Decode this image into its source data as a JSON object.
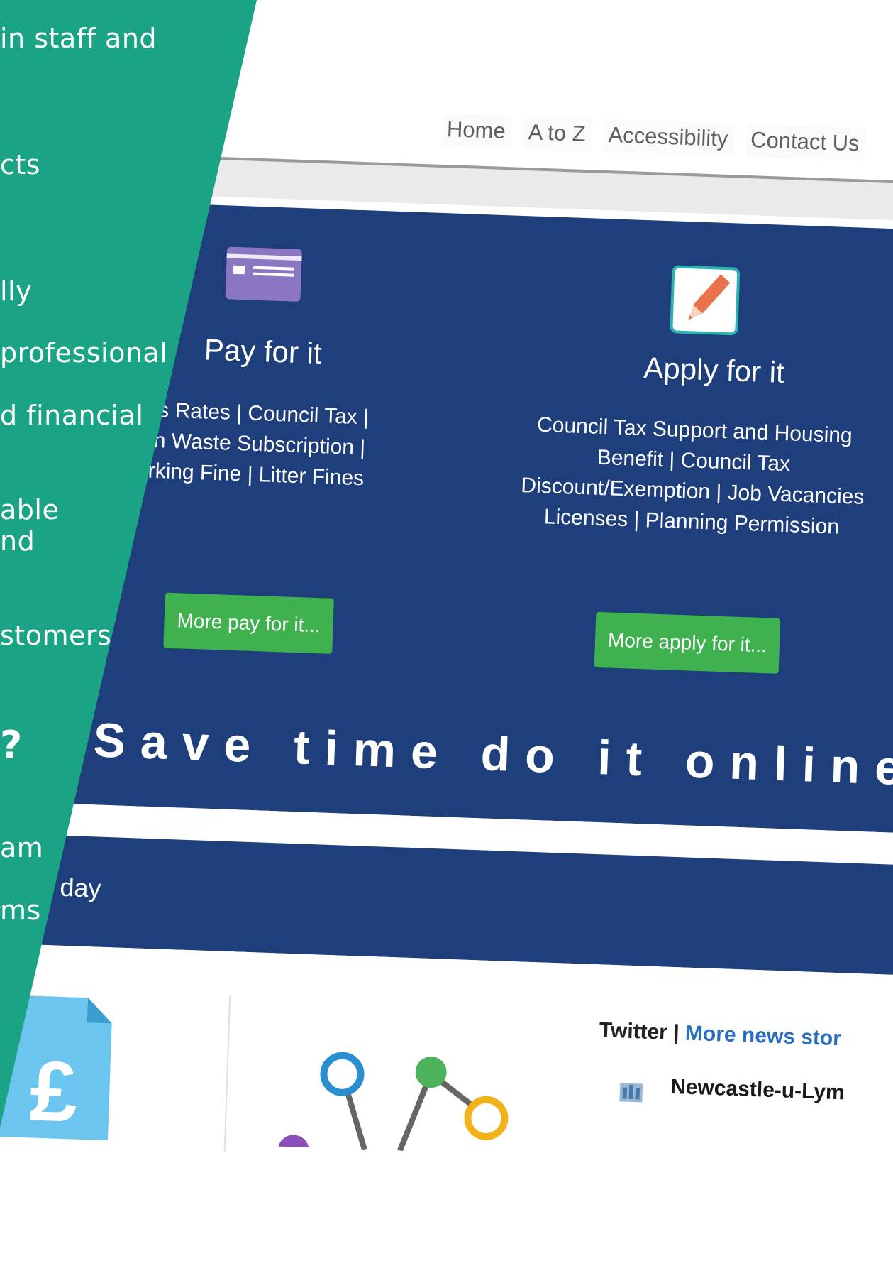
{
  "nav": {
    "items": [
      "Home",
      "A to Z",
      "Accessibility",
      "Contact Us"
    ]
  },
  "pay": {
    "title": "Pay for it",
    "lines": [
      "ness Rates | Council Tax |",
      "rden Waste Subscription |",
      "Parking Fine | Litter Fines"
    ],
    "button": "More pay for it..."
  },
  "apply": {
    "title": "Apply for it",
    "lines": [
      "Council Tax Support and Housing",
      "Benefit | Council Tax",
      "Discount/Exemption | Job Vacancies",
      "Licenses | Planning Permission"
    ],
    "button": "More apply for it..."
  },
  "tagline": "Save time do it online",
  "band_text": "tion day",
  "twitter": {
    "label": "Twitter",
    "separator": "|",
    "link": "More news stor"
  },
  "feed": {
    "name": "Newcastle-u-Lym"
  },
  "panel": {
    "lines": [
      "in staff and",
      "cts",
      "lly",
      "professional",
      "d financial",
      "able",
      "nd",
      "stomers",
      "?",
      "am",
      "ms"
    ]
  },
  "colors": {
    "hero_blue": "#1f3e7c",
    "panel_green": "#1aa384",
    "button_green": "#3fb24f",
    "link_blue": "#2a6fbf"
  },
  "icons": [
    "card-icon",
    "pencil-icon",
    "pound-document-icon",
    "network-nodes-icon",
    "council-crest-icon"
  ]
}
